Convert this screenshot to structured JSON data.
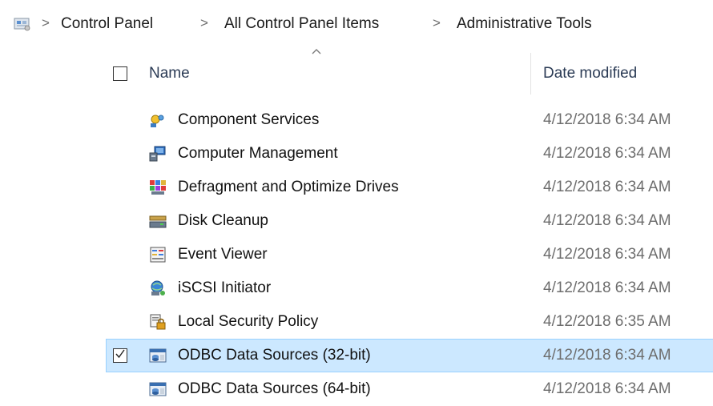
{
  "breadcrumb": {
    "icon": "control-panel-icon",
    "items": [
      "Control Panel",
      "All Control Panel Items",
      "Administrative Tools"
    ],
    "separator": ">"
  },
  "columns": {
    "name": "Name",
    "date_modified": "Date modified",
    "sort": "ascending"
  },
  "rows": [
    {
      "name": "Component Services",
      "date": "4/12/2018 6:34 AM",
      "icon": "component-services-icon",
      "selected": false
    },
    {
      "name": "Computer Management",
      "date": "4/12/2018 6:34 AM",
      "icon": "computer-management-icon",
      "selected": false
    },
    {
      "name": "Defragment and Optimize Drives",
      "date": "4/12/2018 6:34 AM",
      "icon": "defragment-icon",
      "selected": false
    },
    {
      "name": "Disk Cleanup",
      "date": "4/12/2018 6:34 AM",
      "icon": "disk-cleanup-icon",
      "selected": false
    },
    {
      "name": "Event Viewer",
      "date": "4/12/2018 6:34 AM",
      "icon": "event-viewer-icon",
      "selected": false
    },
    {
      "name": "iSCSI Initiator",
      "date": "4/12/2018 6:34 AM",
      "icon": "iscsi-initiator-icon",
      "selected": false
    },
    {
      "name": "Local Security Policy",
      "date": "4/12/2018 6:35 AM",
      "icon": "local-security-policy-icon",
      "selected": false
    },
    {
      "name": "ODBC Data Sources (32-bit)",
      "date": "4/12/2018 6:34 AM",
      "icon": "odbc-icon",
      "selected": true
    },
    {
      "name": "ODBC Data Sources (64-bit)",
      "date": "4/12/2018 6:34 AM",
      "icon": "odbc-icon",
      "selected": false
    }
  ],
  "colors": {
    "selection_bg": "#cce8ff",
    "selection_border": "#99d1ff",
    "header_text": "#2b3b55",
    "date_text": "#6d6d6d"
  }
}
